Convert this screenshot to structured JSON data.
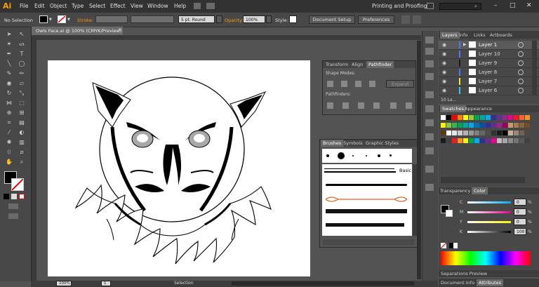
{
  "app": {
    "logo": "Ai"
  },
  "menu": [
    "File",
    "Edit",
    "Object",
    "Type",
    "Select",
    "Effect",
    "View",
    "Window",
    "Help"
  ],
  "workspace": "Printing and Proofing",
  "window_controls": {
    "minimize": "–",
    "maximize": "□",
    "close": "✕"
  },
  "control_bar": {
    "selection": "No Selection",
    "stroke_label": "Stroke:",
    "brush": "5 pt. Round",
    "opacity_label": "Opacity:",
    "opacity_value": "100%",
    "style_label": "Style:",
    "document_setup": "Document Setup",
    "preferences": "Preferences"
  },
  "document": {
    "tab": "Owls Face.ai @ 100% (CMYK/Preview)",
    "close": "✕"
  },
  "pathfinder_panel": {
    "tabs": [
      "Transform",
      "Align",
      "Pathfinder"
    ],
    "shape_modes": "Shape Modes:",
    "pathfinders": "Pathfinders:",
    "expand": "Expand"
  },
  "brushes_panel": {
    "tabs": [
      "Brushes",
      "Symbols",
      "Graphic Styles"
    ],
    "basic": "Basic"
  },
  "layers_panel": {
    "tabs": [
      "Layers",
      "Info",
      "Links",
      "Artboards"
    ],
    "rows": [
      {
        "name": "Layer 1",
        "color": "#4a7bff"
      },
      {
        "name": "Layer 10",
        "color": "#4a7bff"
      },
      {
        "name": "Layer 9",
        "color": "#1a1a1a"
      },
      {
        "name": "Layer 8",
        "color": "#4a7bff"
      },
      {
        "name": "Layer 7",
        "color": "#f0e040"
      },
      {
        "name": "Layer 6",
        "color": "#40c0f0"
      }
    ],
    "count": "10 La..."
  },
  "swatches_panel": {
    "tabs": [
      "Swatches",
      "Appearance"
    ],
    "colors": [
      [
        "#ffffff",
        "#000000",
        "#ff0000",
        "#ff7f00",
        "#ffff00",
        "#9acd32",
        "#00a651",
        "#00a99d",
        "#00aeef",
        "#2e3192",
        "#662d91",
        "#92278f",
        "#ec008c",
        "#ed1c24",
        "#f26522",
        "#f7941d"
      ],
      [
        "#fff200",
        "#8dc63f",
        "#39b54a",
        "#00a651",
        "#00a99d",
        "#00aeef",
        "#0072bc",
        "#0054a6",
        "#2e3192",
        "#662d91",
        "#92278f",
        "#9e005d",
        "#c69c6d",
        "#a67c52",
        "#8c6239",
        "#754c24"
      ],
      [
        "#603913",
        "#ffffff",
        "#e6e6e6",
        "#cccccc",
        "#b3b3b3",
        "#999999",
        "#808080",
        "#666666",
        "#4d4d4d",
        "#333333",
        "#1a1a1a",
        "#000000",
        "#c7b299",
        "#998675",
        "#736357",
        "#534741"
      ],
      [
        "#1a1a1a",
        "#404040",
        "#ed1c24",
        "#f7941d",
        "#fff200",
        "#00a651",
        "#00aeef",
        "#2e3192",
        "#662d91",
        "#ec008c",
        "#bfbfbf",
        "#a6a6a6",
        "#8c8c8c",
        "#737373",
        "#595959",
        "#404040"
      ]
    ]
  },
  "color_panel": {
    "tabs": [
      "Transparency",
      "Color"
    ],
    "sliders": [
      {
        "label": "C",
        "value": "0",
        "unit": "%"
      },
      {
        "label": "M",
        "value": "0",
        "unit": "%"
      },
      {
        "label": "Y",
        "value": "0",
        "unit": "%"
      },
      {
        "label": "K",
        "value": "100",
        "unit": "%"
      }
    ]
  },
  "separations": "Separations Preview",
  "bottom_tabs": [
    "Document Info",
    "Attributes"
  ],
  "status": {
    "zoom": "100%",
    "page": "1",
    "mode": "Selection"
  }
}
